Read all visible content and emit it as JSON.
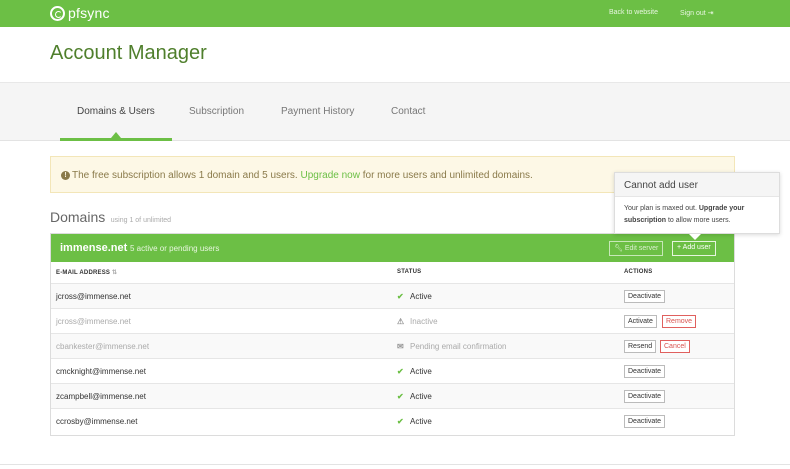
{
  "brand": {
    "name": "pfsync",
    "color": "#6cbf45"
  },
  "topnav": {
    "back": "Back to website",
    "signout": "Sign out",
    "signout_icon": "sign-out-icon"
  },
  "page": {
    "title": "Account Manager"
  },
  "tabs": [
    {
      "label": "Domains & Users",
      "active": true
    },
    {
      "label": "Subscription",
      "active": false
    },
    {
      "label": "Payment History",
      "active": false
    },
    {
      "label": "Contact",
      "active": false
    }
  ],
  "alert": {
    "icon": "info-icon",
    "text_before": "The free subscription allows 1 domain and 5 users.",
    "link": "Upgrade now",
    "text_after": "for more users and unlimited domains."
  },
  "domains": {
    "title": "Domains",
    "usage": "using 1 of unlimited"
  },
  "tooltip": {
    "title": "Cannot add user",
    "text_before": "Your plan is maxed out.",
    "bold": "Upgrade your subscription",
    "text_after": "to allow more users."
  },
  "domain": {
    "name": "immense.net",
    "summary": "5 active or pending users",
    "edit_label": "Edit server",
    "add_label": "Add user"
  },
  "table": {
    "headers": {
      "email": "E-MAIL ADDRESS",
      "status": "STATUS",
      "actions": "ACTIONS"
    },
    "rows": [
      {
        "email": "jcross@immense.net",
        "status": "Active",
        "status_icon": "check-icon",
        "actions": [
          "Deactivate"
        ]
      },
      {
        "email": "jcross@immense.net",
        "status": "Inactive",
        "status_icon": "warning-icon",
        "actions": [
          "Activate",
          "Remove"
        ]
      },
      {
        "email": "cbankester@immense.net",
        "status": "Pending email confirmation",
        "status_icon": "envelope-icon",
        "actions": [
          "Resend",
          "Cancel"
        ]
      },
      {
        "email": "cmcknight@immense.net",
        "status": "Active",
        "status_icon": "check-icon",
        "actions": [
          "Deactivate"
        ]
      },
      {
        "email": "zcampbell@immense.net",
        "status": "Active",
        "status_icon": "check-icon",
        "actions": [
          "Deactivate"
        ]
      },
      {
        "email": "ccrosby@immense.net",
        "status": "Active",
        "status_icon": "check-icon",
        "actions": [
          "Deactivate"
        ]
      }
    ]
  }
}
